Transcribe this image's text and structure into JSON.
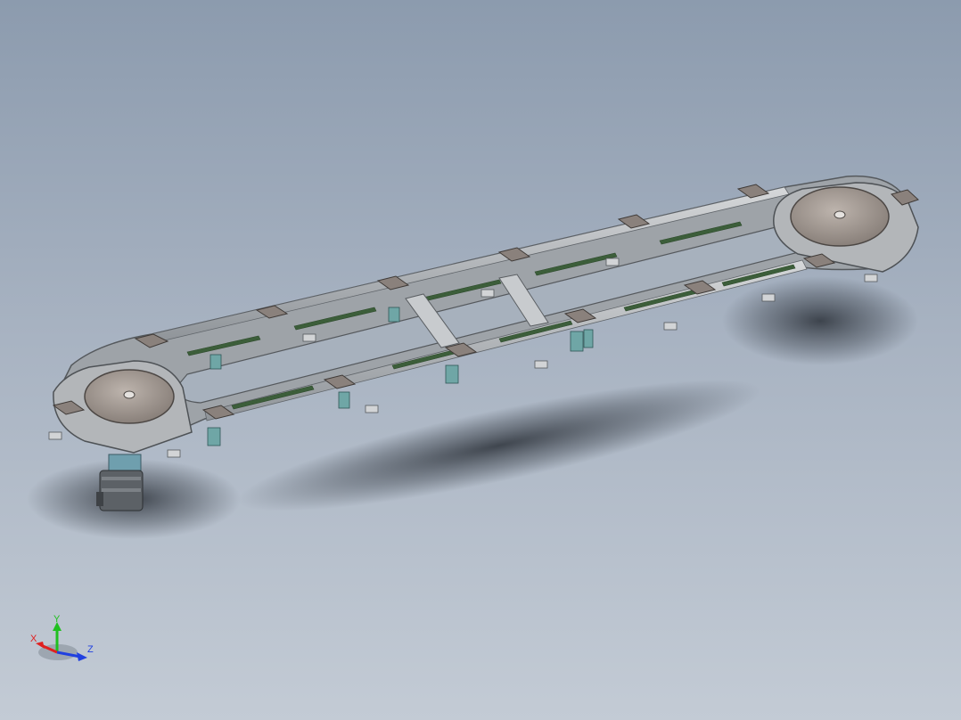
{
  "viewport": {
    "background_top": "#8c9bae",
    "background_bottom": "#c3cbd5"
  },
  "model": {
    "frame_color": "#b9bcbf",
    "rail_color": "#9ea3a8",
    "guide_color": "#3c5e3a",
    "plate_color": "#8a817c",
    "bracket_color": "#6fa6a6",
    "disk_color": "#a79e98"
  },
  "triad": {
    "x_label": "X",
    "y_label": "Y",
    "z_label": "Z",
    "x_color": "#e02020",
    "y_color": "#20c020",
    "z_color": "#2040e0"
  }
}
